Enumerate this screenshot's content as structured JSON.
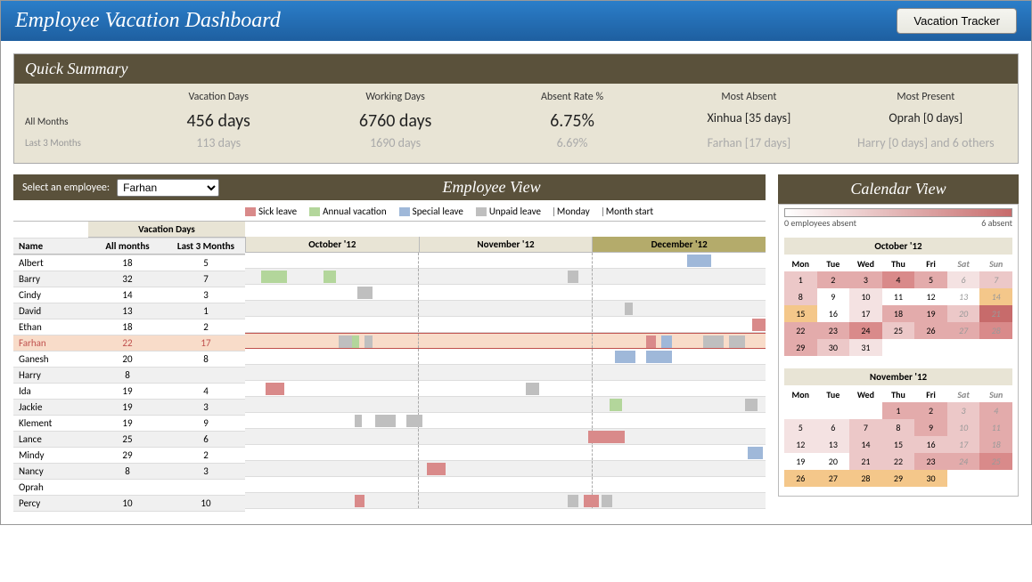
{
  "title": "Employee Vacation Dashboard",
  "tracker_btn": "Vacation Tracker",
  "quick_summary": {
    "header": "Quick Summary",
    "cols": [
      "Vacation Days",
      "Working Days",
      "Absent Rate %",
      "Most Absent",
      "Most Present"
    ],
    "rows": [
      "All Months",
      "Last 3 Months"
    ],
    "all": {
      "vac": "456 days",
      "work": "6760 days",
      "rate": "6.75%",
      "absent": "Xinhua [35 days]",
      "present": "Oprah [0 days]"
    },
    "last3": {
      "vac": "113 days",
      "work": "1690 days",
      "rate": "6.69%",
      "absent": "Farhan [17 days]",
      "present": "Harry [0 days] and 6 others"
    }
  },
  "employee_view": {
    "select_lbl": "Select an employee:",
    "selected": "Farhan",
    "title": "Employee View",
    "legend": {
      "sick": "Sick leave",
      "annual": "Annual vacation",
      "special": "Special leave",
      "unpaid": "Unpaid leave",
      "monday": "Monday",
      "month": "Month start"
    },
    "table_hdr": {
      "vacdays": "Vacation Days",
      "name": "Name",
      "all": "All months",
      "last3": "Last 3 Months"
    },
    "months": [
      "October '12",
      "November '12",
      "December '12"
    ],
    "employees": [
      {
        "name": "Albert",
        "all": 18,
        "last3": 5,
        "blocks": [
          {
            "l": 85,
            "w": 4.5,
            "c": "c-special"
          }
        ]
      },
      {
        "name": "Barry",
        "all": 32,
        "last3": 7,
        "blocks": [
          {
            "l": 3,
            "w": 5,
            "c": "c-annual"
          },
          {
            "l": 15,
            "w": 2.5,
            "c": "c-annual"
          },
          {
            "l": 62,
            "w": 2,
            "c": "c-unpaid"
          }
        ]
      },
      {
        "name": "Cindy",
        "all": 14,
        "last3": 3,
        "blocks": [
          {
            "l": 21.5,
            "w": 3,
            "c": "c-unpaid"
          }
        ]
      },
      {
        "name": "David",
        "all": 13,
        "last3": 1,
        "blocks": [
          {
            "l": 73,
            "w": 1.5,
            "c": "c-unpaid"
          }
        ]
      },
      {
        "name": "Ethan",
        "all": 18,
        "last3": 2,
        "blocks": [
          {
            "l": 97.5,
            "w": 2.5,
            "c": "c-sick"
          }
        ]
      },
      {
        "name": "Farhan",
        "all": 22,
        "last3": 17,
        "sel": true,
        "blocks": [
          {
            "l": 18,
            "w": 2.5,
            "c": "c-unpaid"
          },
          {
            "l": 20.5,
            "w": 1.5,
            "c": "c-annual"
          },
          {
            "l": 23,
            "w": 1.5,
            "c": "c-unpaid"
          },
          {
            "l": 77,
            "w": 2,
            "c": "c-sick"
          },
          {
            "l": 80,
            "w": 2,
            "c": "c-special"
          },
          {
            "l": 88,
            "w": 4,
            "c": "c-unpaid"
          },
          {
            "l": 93,
            "w": 3,
            "c": "c-unpaid"
          }
        ]
      },
      {
        "name": "Ganesh",
        "all": 20,
        "last3": 8,
        "blocks": [
          {
            "l": 71,
            "w": 4,
            "c": "c-special"
          },
          {
            "l": 77,
            "w": 5,
            "c": "c-special"
          }
        ]
      },
      {
        "name": "Harry",
        "all": 8,
        "last3": "",
        "blocks": []
      },
      {
        "name": "Ida",
        "all": 19,
        "last3": 4,
        "blocks": [
          {
            "l": 4,
            "w": 3.5,
            "c": "c-sick"
          },
          {
            "l": 54,
            "w": 2.5,
            "c": "c-unpaid"
          }
        ]
      },
      {
        "name": "Jackie",
        "all": 19,
        "last3": 3,
        "blocks": [
          {
            "l": 70,
            "w": 2.5,
            "c": "c-annual"
          },
          {
            "l": 96,
            "w": 2.5,
            "c": "c-unpaid"
          }
        ]
      },
      {
        "name": "Klement",
        "all": 19,
        "last3": 9,
        "blocks": [
          {
            "l": 21,
            "w": 1.5,
            "c": "c-unpaid"
          },
          {
            "l": 25,
            "w": 4,
            "c": "c-unpaid"
          },
          {
            "l": 31,
            "w": 3,
            "c": "c-unpaid"
          }
        ]
      },
      {
        "name": "Lance",
        "all": 25,
        "last3": 6,
        "blocks": [
          {
            "l": 66,
            "w": 7,
            "c": "c-sick"
          }
        ]
      },
      {
        "name": "Mindy",
        "all": 29,
        "last3": 2,
        "blocks": [
          {
            "l": 96.5,
            "w": 3,
            "c": "c-special"
          }
        ]
      },
      {
        "name": "Nancy",
        "all": 8,
        "last3": 3,
        "blocks": [
          {
            "l": 35,
            "w": 3.5,
            "c": "c-sick"
          }
        ]
      },
      {
        "name": "Oprah",
        "all": "",
        "last3": "",
        "blocks": []
      },
      {
        "name": "Percy",
        "all": 10,
        "last3": 10,
        "blocks": [
          {
            "l": 21,
            "w": 2,
            "c": "c-sick"
          },
          {
            "l": 62,
            "w": 2,
            "c": "c-unpaid"
          },
          {
            "l": 65,
            "w": 3,
            "c": "c-sick"
          },
          {
            "l": 68.5,
            "w": 2,
            "c": "c-unpaid"
          }
        ]
      }
    ]
  },
  "calendar_view": {
    "title": "Calendar View",
    "legend_min": "0 employees absent",
    "legend_max": "6 absent",
    "dow": [
      "Mon",
      "Tue",
      "Wed",
      "Thu",
      "Fri",
      "Sat",
      "Sun"
    ],
    "months": [
      {
        "title": "October '12",
        "weeks": [
          [
            {
              "d": 1,
              "h": 2
            },
            {
              "d": 2,
              "h": 3
            },
            {
              "d": 3,
              "h": 3
            },
            {
              "d": 4,
              "h": 4
            },
            {
              "d": 5,
              "h": 3
            },
            {
              "d": 6,
              "h": 1,
              "wk": 1
            },
            {
              "d": 7,
              "h": 2,
              "wk": 1
            }
          ],
          [
            {
              "d": 8,
              "h": 2
            },
            {
              "d": 9,
              "h": 0
            },
            {
              "d": 10,
              "h": 1
            },
            {
              "d": 11,
              "h": 0
            },
            {
              "d": 12,
              "h": 0
            },
            {
              "d": 13,
              "h": 0,
              "wk": 1
            },
            {
              "d": 14,
              "h": -1,
              "wk": 1
            }
          ],
          [
            {
              "d": 15,
              "h": -1
            },
            {
              "d": 16,
              "h": 0
            },
            {
              "d": 17,
              "h": 1
            },
            {
              "d": 18,
              "h": 3
            },
            {
              "d": 19,
              "h": 3
            },
            {
              "d": 20,
              "h": 2,
              "wk": 1
            },
            {
              "d": 21,
              "h": 5,
              "wk": 1
            }
          ],
          [
            {
              "d": 22,
              "h": 3
            },
            {
              "d": 23,
              "h": 3
            },
            {
              "d": 24,
              "h": 4
            },
            {
              "d": 25,
              "h": 2
            },
            {
              "d": 26,
              "h": 3
            },
            {
              "d": 27,
              "h": 3,
              "wk": 1
            },
            {
              "d": 28,
              "h": 4,
              "wk": 1
            }
          ],
          [
            {
              "d": 29,
              "h": 3
            },
            {
              "d": 30,
              "h": 2
            },
            {
              "d": 31,
              "h": 1
            },
            null,
            null,
            null,
            null
          ]
        ]
      },
      {
        "title": "November '12",
        "weeks": [
          [
            null,
            null,
            null,
            {
              "d": 1,
              "h": 3
            },
            {
              "d": 2,
              "h": 3
            },
            {
              "d": 3,
              "h": 2,
              "wk": 1
            },
            {
              "d": 4,
              "h": 3,
              "wk": 1
            }
          ],
          [
            {
              "d": 5,
              "h": 1
            },
            {
              "d": 6,
              "h": 1
            },
            {
              "d": 7,
              "h": 2
            },
            {
              "d": 8,
              "h": 2
            },
            {
              "d": 9,
              "h": 3
            },
            {
              "d": 10,
              "h": 2,
              "wk": 1
            },
            {
              "d": 11,
              "h": 3,
              "wk": 1
            }
          ],
          [
            {
              "d": 12,
              "h": 1
            },
            {
              "d": 13,
              "h": 1
            },
            {
              "d": 14,
              "h": 2
            },
            {
              "d": 15,
              "h": 2
            },
            {
              "d": 16,
              "h": 2
            },
            {
              "d": 17,
              "h": 2,
              "wk": 1
            },
            {
              "d": 18,
              "h": 3,
              "wk": 1
            }
          ],
          [
            {
              "d": 19,
              "h": 0
            },
            {
              "d": 20,
              "h": 0
            },
            {
              "d": 21,
              "h": 2
            },
            {
              "d": 22,
              "h": 2
            },
            {
              "d": 23,
              "h": 3
            },
            {
              "d": 24,
              "h": 3,
              "wk": 1
            },
            {
              "d": 25,
              "h": 4,
              "wk": 1
            }
          ],
          [
            {
              "d": 26,
              "h": -1
            },
            {
              "d": 27,
              "h": -1
            },
            {
              "d": 28,
              "h": -1
            },
            {
              "d": 29,
              "h": -1
            },
            {
              "d": 30,
              "h": -1
            },
            null,
            null
          ]
        ]
      }
    ]
  }
}
